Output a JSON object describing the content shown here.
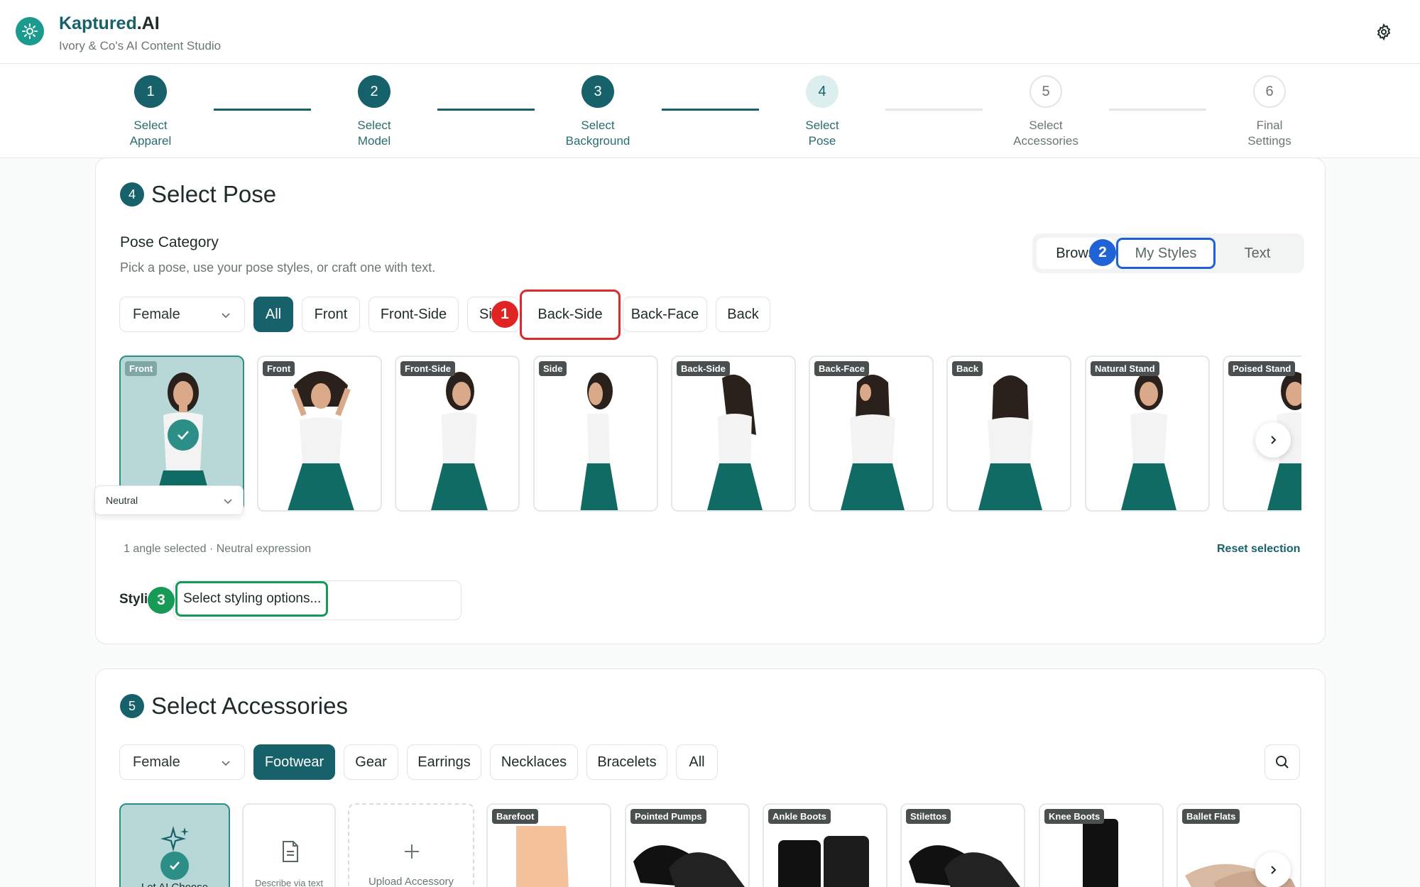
{
  "app": {
    "brand_main": "Kaptured",
    "brand_suffix": ".AI",
    "subtitle": "Ivory & Co's AI Content Studio"
  },
  "stepper": [
    {
      "num": "1",
      "label": "Select\nApparel",
      "state": "done"
    },
    {
      "num": "2",
      "label": "Select\nModel",
      "state": "done"
    },
    {
      "num": "3",
      "label": "Select\nBackground",
      "state": "done"
    },
    {
      "num": "4",
      "label": "Select\nPose",
      "state": "current"
    },
    {
      "num": "5",
      "label": "Select\nAccessories",
      "state": "todo"
    },
    {
      "num": "6",
      "label": "Final\nSettings",
      "state": "todo"
    }
  ],
  "pose": {
    "number": "4",
    "title": "Select Pose",
    "category_title": "Pose Category",
    "description": "Pick a pose, use your pose styles, or craft one with text.",
    "modes": {
      "browse": "Brows",
      "my_styles": "My Styles",
      "text": "Text"
    },
    "gender": "Female",
    "filters": [
      "All",
      "Front",
      "Front-Side",
      "Si",
      "Back-Side",
      "Back-Face",
      "Back"
    ],
    "tiles": [
      "Front",
      "Front",
      "Front-Side",
      "Side",
      "Back-Side",
      "Back-Face",
      "Back",
      "Natural Stand",
      "Poised Stand"
    ],
    "expression": "Neutral",
    "status": "1 angle selected · Neutral expression",
    "reset": "Reset selection",
    "styling_label": "Styli",
    "styling_placeholder": "Select styling options..."
  },
  "badges": {
    "one": "1",
    "two": "2",
    "three": "3"
  },
  "accessories": {
    "number": "5",
    "title": "Select Accessories",
    "gender": "Female",
    "filters": [
      "Footwear",
      "Gear",
      "Earrings",
      "Necklaces",
      "Bracelets",
      "All"
    ],
    "special_tiles": {
      "ai": "Let AI Choose",
      "describe": "Describe via text",
      "upload": "Upload Accessory"
    },
    "tiles": [
      "Barefoot",
      "Pointed Pumps",
      "Ankle Boots",
      "Stilettos",
      "Knee Boots",
      "Ballet Flats"
    ]
  },
  "colors": {
    "brand": "#17626a",
    "accent_red": "#e02424",
    "accent_blue": "#1f63d6",
    "accent_green": "#169a55"
  },
  "icons": [
    "logo-icon",
    "gear-icon",
    "chevron-down-icon",
    "check-icon",
    "chevron-right-icon",
    "search-icon",
    "sparkles-icon",
    "document-icon",
    "plus-icon"
  ]
}
